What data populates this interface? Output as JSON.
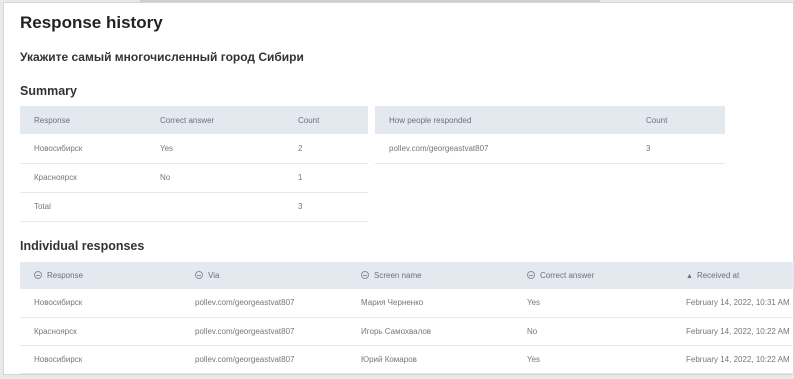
{
  "page": {
    "title": "Response history",
    "question": "Укажите самый многочисленный город Сибири"
  },
  "summary": {
    "title": "Summary",
    "headers": [
      "Response",
      "Correct answer",
      "Count"
    ],
    "rows": [
      [
        "Новосибирск",
        "Yes",
        "2"
      ],
      [
        "Красноярск",
        "No",
        "1"
      ],
      [
        "Total",
        "",
        "3"
      ]
    ]
  },
  "how_responded": {
    "headers": [
      "How people responded",
      "Count"
    ],
    "rows": [
      [
        "pollev.com/georgeastvat807",
        "3"
      ]
    ]
  },
  "individual": {
    "title": "Individual responses",
    "headers": [
      "Response",
      "Via",
      "Screen name",
      "Correct answer",
      "Received at"
    ],
    "rows": [
      [
        "Новосибирск",
        "pollev.com/georgeastvat807",
        "Мария Черненко",
        "Yes",
        "February 14, 2022, 10:31 AM"
      ],
      [
        "Красноярск",
        "pollev.com/georgeastvat807",
        "Игорь Самохвалов",
        "No",
        "February 14, 2022, 10:22 AM"
      ],
      [
        "Новосибирск",
        "pollev.com/georgeastvat807",
        "Юрий Комаров",
        "Yes",
        "February 14, 2022, 10:22 AM"
      ]
    ]
  },
  "icons": {
    "sortable": "sort-icon",
    "sorted_asc": "sort-ascending-icon"
  }
}
